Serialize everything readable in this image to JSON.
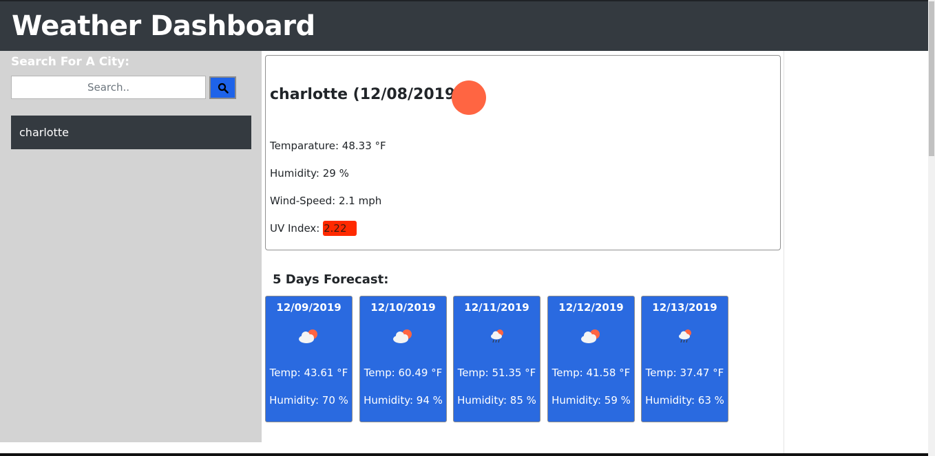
{
  "header": {
    "title": "Weather Dashboard"
  },
  "sidebar": {
    "search_label": "Search For A City:",
    "search_placeholder": "Search..",
    "search_value": "",
    "search_button_icon": "search-icon",
    "history": [
      {
        "label": "charlotte"
      }
    ]
  },
  "current": {
    "title": "charlotte (12/08/2019)",
    "icon": "sun-icon",
    "icon_color": "#ff6542",
    "temperature": "Temparature: 48.33 °F",
    "humidity": "Humidity: 29 %",
    "wind": "Wind-Speed: 2.1 mph",
    "uv_label": "UV Index: ",
    "uv_value": "2.22",
    "uv_color": "#ff2a00"
  },
  "forecast": {
    "title": "5 Days Forecast:",
    "days": [
      {
        "date": "12/09/2019",
        "icon": "partly-cloudy-icon",
        "temp": "Temp: 43.61 °F",
        "humidity": "Humidity: 70 %"
      },
      {
        "date": "12/10/2019",
        "icon": "partly-cloudy-icon",
        "temp": "Temp: 60.49 °F",
        "humidity": "Humidity: 94 %"
      },
      {
        "date": "12/11/2019",
        "icon": "rain-cloud-icon",
        "temp": "Temp: 51.35 °F",
        "humidity": "Humidity: 85 %"
      },
      {
        "date": "12/12/2019",
        "icon": "partly-cloudy-icon",
        "temp": "Temp: 41.58 °F",
        "humidity": "Humidity: 59 %"
      },
      {
        "date": "12/13/2019",
        "icon": "rain-cloud-icon",
        "temp": "Temp: 37.47 °F",
        "humidity": "Humidity: 63 %"
      }
    ],
    "card_color": "#2a6ae0"
  }
}
